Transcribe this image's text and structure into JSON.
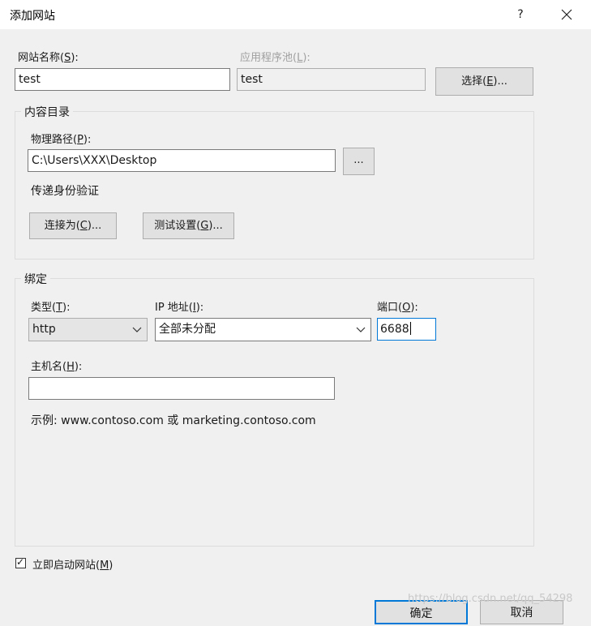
{
  "window": {
    "title": "添加网站",
    "help_glyph": "?",
    "close_glyph": "✕"
  },
  "site_name": {
    "label_text": "网站名称(",
    "label_key": "S",
    "label_end": "):",
    "value": "test"
  },
  "app_pool": {
    "label_text": "应用程序池(",
    "label_key": "L",
    "label_end": "):",
    "value": "test",
    "select_text": "选择(",
    "select_key": "E",
    "select_end": ")..."
  },
  "content_dir": {
    "group_title": "内容目录",
    "physical_path_text": "物理路径(",
    "physical_path_key": "P",
    "physical_path_end": "):",
    "physical_path_value": "C:\\Users\\XXX\\Desktop",
    "browse_label": "...",
    "pass_auth_label": "传递身份验证",
    "connect_as_text": "连接为(",
    "connect_as_key": "C",
    "connect_as_end": ")...",
    "test_settings_text": "测试设置(",
    "test_settings_key": "G",
    "test_settings_end": ")..."
  },
  "binding": {
    "group_title": "绑定",
    "type_text": "类型(",
    "type_key": "T",
    "type_end": "):",
    "type_value": "http",
    "ip_text": "IP 地址(",
    "ip_key": "I",
    "ip_end": "):",
    "ip_value": "全部未分配",
    "port_text": "端口(",
    "port_key": "O",
    "port_end": "):",
    "port_value": "6688",
    "host_text": "主机名(",
    "host_key": "H",
    "host_end": "):",
    "host_value": "",
    "example": "示例: www.contoso.com 或 marketing.contoso.com"
  },
  "start_immediately": {
    "checked": true,
    "check_glyph": "✓",
    "label_text": "立即启动网站(",
    "label_key": "M",
    "label_end": ")"
  },
  "footer": {
    "ok_label": "确定",
    "cancel_label": "取消",
    "watermark": "https://blog.csdn.net/qq_54298"
  },
  "colors": {
    "focus_border": "#0078d7",
    "window_bg": "#f0f0f0"
  }
}
